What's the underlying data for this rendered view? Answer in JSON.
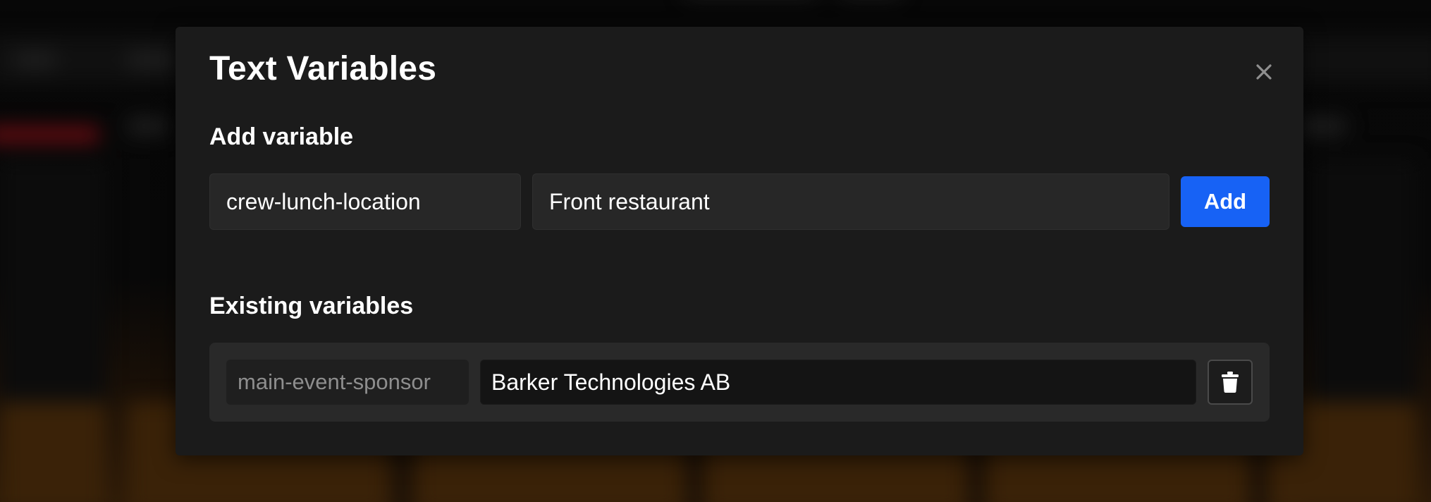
{
  "modal": {
    "title": "Text Variables",
    "close_icon": "close-icon"
  },
  "add_section": {
    "title": "Add variable",
    "key_value": "crew-lunch-location",
    "value_value": "Front restaurant",
    "add_label": "Add",
    "add_color": "#1762f5"
  },
  "existing_section": {
    "title": "Existing variables",
    "variables": [
      {
        "key": "main-event-sponsor",
        "value": "Barker Technologies AB",
        "delete_icon": "trash-icon"
      }
    ]
  }
}
